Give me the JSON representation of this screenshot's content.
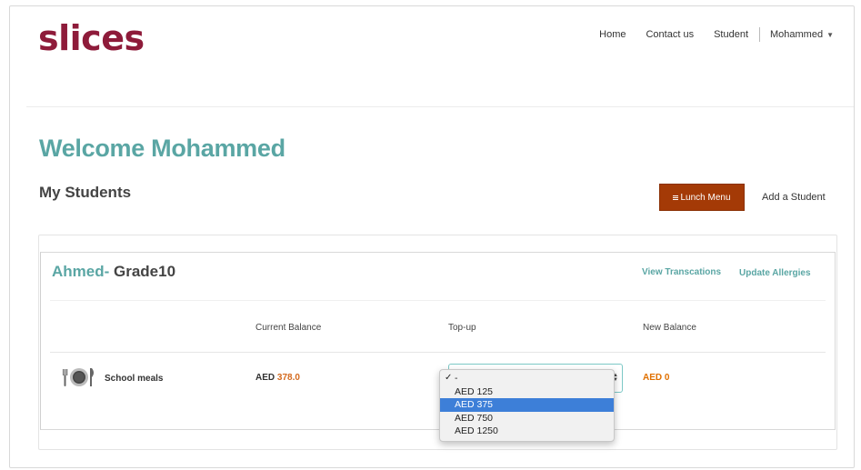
{
  "brand": {
    "logo_text": "slices",
    "color": "#8e1b3a"
  },
  "nav": {
    "home": "Home",
    "contact": "Contact us",
    "student": "Student",
    "user": "Mohammed"
  },
  "page": {
    "welcome": "Welcome Mohammed",
    "section_title": "My Students",
    "lunch_menu_button": "Lunch Menu",
    "add_student_link": "Add a Student"
  },
  "student_card": {
    "first_name": "Ahmed-",
    "grade": " Grade10",
    "view_transactions": "View Transcations",
    "update_allergies": "Update Allergies",
    "columns": {
      "current_balance": "Current Balance",
      "topup": "Top-up",
      "new_balance": "New Balance"
    },
    "row": {
      "service": "School meals",
      "service_icon": "plate-cutlery-icon",
      "balance_currency": "AED ",
      "balance_amount": "378.0",
      "new_balance": "AED 0"
    }
  },
  "topup_dropdown": {
    "selected": "-",
    "check": "✓",
    "options": [
      "-",
      "AED 125",
      "AED 375",
      "AED 750",
      "AED 1250"
    ],
    "highlighted_index": 2
  },
  "colors": {
    "teal": "#5aa6a4",
    "button": "#a43a06",
    "accent_orange": "#e07000",
    "highlight": "#3d7fd8"
  }
}
